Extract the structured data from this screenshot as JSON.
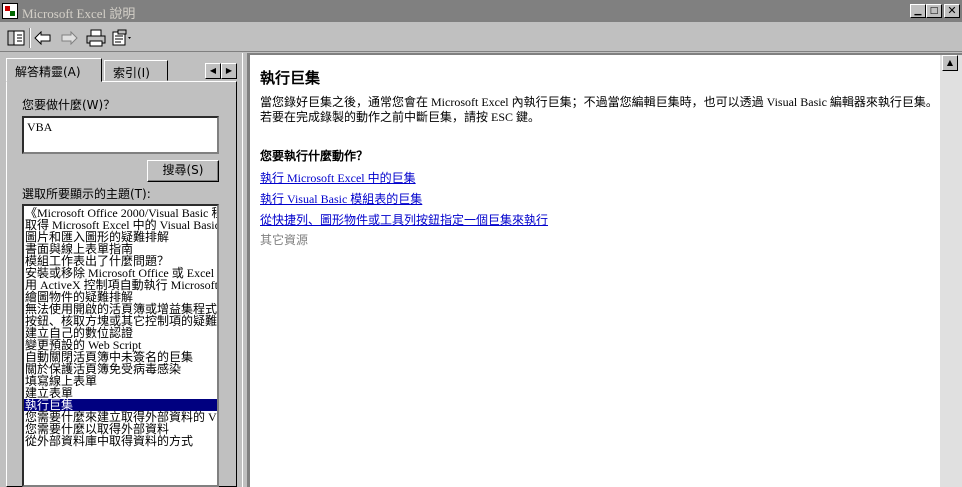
{
  "window": {
    "title": "Microsoft Excel 說明"
  },
  "toolbar": {
    "hide_icon": "hide-pane-icon",
    "back_icon": "back-arrow-icon",
    "forward_icon": "forward-arrow-icon",
    "print_icon": "print-icon",
    "options_icon": "options-icon"
  },
  "left": {
    "tabs": [
      {
        "label": "解答精靈(A)"
      },
      {
        "label": "索引(I)"
      }
    ],
    "question_label": "您要做什麼(W)？",
    "question_value": "VBA",
    "search_label": "搜尋(S)",
    "topics_label": "選取所要顯示的主題(T):",
    "topics": [
      "《Microsoft Office 2000/Visual Basic 程",
      "取得 Microsoft Excel 中的 Visual Basic 說",
      "圖片和匯入圖形的疑難排解",
      "書面與線上表單指南",
      "模組工作表出了什麼問題？",
      "安裝或移除 Microsoft Office 或 Excel 的",
      "用 ActiveX 控制項自動執行 Microsoft",
      "繪圖物件的疑難排解",
      "無法使用開啟的活頁簿或增益集程式",
      "按鈕、核取方塊或其它控制項的疑難",
      "建立自己的數位認證",
      "變更預設的 Web Script",
      "自動關閉活頁簿中未簽名的巨集",
      "關於保護活頁簿免受病毒感染",
      "填寫線上表單",
      "建立表單",
      "執行巨集",
      "您需要什麼來建立取得外部資料的 V",
      "您需要什麼以取得外部資料",
      "從外部資料庫中取得資料的方式"
    ],
    "selected_topic_index": 16
  },
  "content": {
    "title": "執行巨集",
    "paragraph": "當您錄好巨集之後，通常您會在 Microsoft Excel 內執行巨集；不過當您編輯巨集時，也可以透過 Visual Basic 編輯器來執行巨集。若要在完成錄製的動作之前中斷巨集，請按 ESC 鍵。",
    "question": "您要執行什麼動作？",
    "links": [
      "執行 Microsoft Excel 中的巨集",
      "執行 Visual Basic 模組表的巨集",
      "從快捷列、圖形物件或工具列按鈕指定一個巨集來執行"
    ],
    "other": "其它資源"
  }
}
